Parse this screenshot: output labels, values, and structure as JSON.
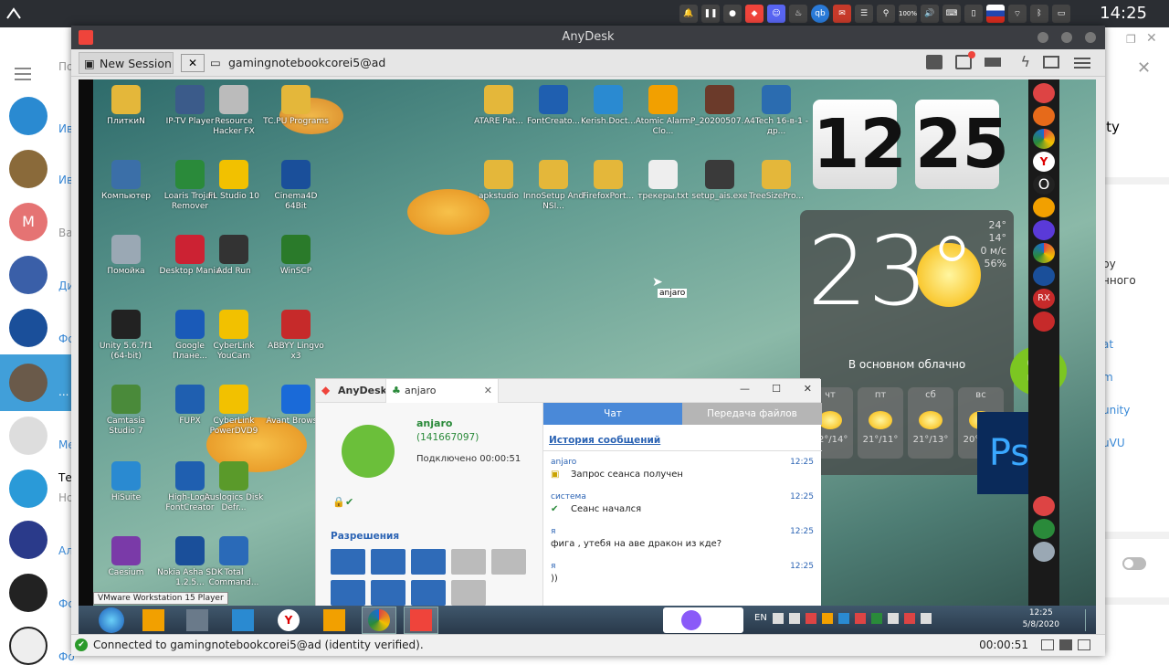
{
  "system": {
    "clock": "14:25",
    "battery": "100%"
  },
  "telegram": {
    "search_placeholder": "По",
    "chats": [
      {
        "sub": "Ив"
      },
      {
        "sub": "Ив"
      },
      {
        "avatar_letter": "M",
        "sub": "Ва"
      },
      {
        "sub": "Ди"
      },
      {
        "sub": "Фо"
      },
      {
        "sub": "..."
      },
      {
        "sub": "Ме"
      },
      {
        "name": "Те",
        "sub": "Но"
      },
      {
        "sub": "Ал"
      },
      {
        "sub": "Фо"
      },
      {
        "sub": "Фо"
      }
    ],
    "right_panel": [
      "ity",
      "ру",
      "нного",
      "at",
      "m",
      "unity",
      "uVU"
    ]
  },
  "anydesk": {
    "title": "AnyDesk",
    "tabs": {
      "new_session": "New Session",
      "remote": "gamingnotebookcorei5@ad"
    },
    "status_text": "Connected to gamingnotebookcorei5@ad (identity verified).",
    "timer": "00:00:51"
  },
  "remote_desktop": {
    "icons": [
      {
        "label": "ПлиткиN",
        "color": "#e4b73a"
      },
      {
        "label": "IP-TV Player",
        "color": "#3b5b8a"
      },
      {
        "label": "Resource Hacker FX",
        "color": "#bbbbbb"
      },
      {
        "label": "TC.PU Programs",
        "color": "#e4b73a"
      },
      {
        "label": "ATARE Pat...",
        "color": "#e4b73a"
      },
      {
        "label": "FontCreato...",
        "color": "#1f5fb0"
      },
      {
        "label": "Kerish.Doct...",
        "color": "#2a8ad1"
      },
      {
        "label": "Atomic Alarm Clo...",
        "color": "#f2a000"
      },
      {
        "label": "P_20200507...",
        "color": "#6b3a2a"
      },
      {
        "label": "A4Tech 16-в-1 - др...",
        "color": "#2b6cb0"
      },
      {
        "label": "Компьютер",
        "color": "#3b6fa8"
      },
      {
        "label": "Loaris Trojan Remover",
        "color": "#2a8a3a"
      },
      {
        "label": "FL Studio 10",
        "color": "#f2c100"
      },
      {
        "label": "Cinema4D 64Bit",
        "color": "#1a4f9a"
      },
      {
        "label": "apkstudio",
        "color": "#e4b73a"
      },
      {
        "label": "InnoSetup And NSI...",
        "color": "#e4b73a"
      },
      {
        "label": "FirefoxPort...",
        "color": "#e4b73a"
      },
      {
        "label": "трекеры.txt",
        "color": "#eeeeee"
      },
      {
        "label": "setup_ais.exe",
        "color": "#3a3a3a"
      },
      {
        "label": "TreeSizePro...",
        "color": "#e4b73a"
      },
      {
        "label": "Помойка",
        "color": "#9aa8b4"
      },
      {
        "label": "Desktop Mania",
        "color": "#cc2233"
      },
      {
        "label": "Add Run",
        "color": "#333333"
      },
      {
        "label": "WinSCP",
        "color": "#2a7a2a"
      },
      {
        "label": "Unity 5.6.7f1 (64-bit)",
        "color": "#222222"
      },
      {
        "label": "Google Плане...",
        "color": "#1a5ab8"
      },
      {
        "label": "CyberLink YouCam",
        "color": "#f2c100"
      },
      {
        "label": "ABBYY Lingvo x3",
        "color": "#c62a2a"
      },
      {
        "label": "Camtasia Studio 7",
        "color": "#4a8a3a"
      },
      {
        "label": "FUPX",
        "color": "#1f5fb0"
      },
      {
        "label": "CyberLink PowerDVD9",
        "color": "#f2c100"
      },
      {
        "label": "Avant Browser",
        "color": "#1a6ad8"
      },
      {
        "label": "HiSuite",
        "color": "#2a8ad1"
      },
      {
        "label": "High-Logic FontCreator",
        "color": "#1f5fb0"
      },
      {
        "label": "Auslogics Disk Defr...",
        "color": "#5a9a2a"
      },
      {
        "label": "Caesium",
        "color": "#7a3aa8"
      },
      {
        "label": "Nokia Asha SDK 1.2.5...",
        "color": "#1a4f9a"
      },
      {
        "label": "Total Command...",
        "color": "#2a6ab8"
      }
    ],
    "cursor_label": "anjaro",
    "clock_widget": {
      "hours": "12",
      "minutes": "25"
    },
    "weather": {
      "temp": "23°",
      "hi": "24°",
      "lo": "14°",
      "wind": "0 м/с",
      "humidity": "56%",
      "desc": "В основном облачно",
      "forecast": [
        {
          "day": "чт",
          "temp": "22°/14°"
        },
        {
          "day": "пт",
          "temp": "21°/11°"
        },
        {
          "day": "сб",
          "temp": "21°/13°"
        },
        {
          "day": "вс",
          "temp": "20°/11°"
        }
      ]
    },
    "tooltip": "VMware Workstation 15 Player",
    "tray": {
      "lang": "EN",
      "time": "12:25",
      "date": "5/8/2020"
    }
  },
  "chat_window": {
    "brand": "AnyDesk",
    "tab": "anjaro",
    "user": {
      "name": "anjaro",
      "id": "(141667097)",
      "connected": "Подключено 00:00:51"
    },
    "permissions_label": "Разрешения",
    "tabs": {
      "chat": "Чат",
      "files": "Передача файлов"
    },
    "history_label": "История сообщений",
    "messages": [
      {
        "sender": "anjaro",
        "time": "12:25",
        "text": "Запрос сеанса получен"
      },
      {
        "sender": "система",
        "time": "12:25",
        "text": "Сеанс начался"
      },
      {
        "sender": "я",
        "time": "12:25",
        "text": "фига , утебя на аве дракон из кде?"
      },
      {
        "sender": "я",
        "time": "12:25",
        "text": "))"
      }
    ]
  },
  "colors": {
    "anydesk_red": "#ef443b",
    "chat_tab": "#4a89d8",
    "telegram_accent": "#419fd9"
  }
}
